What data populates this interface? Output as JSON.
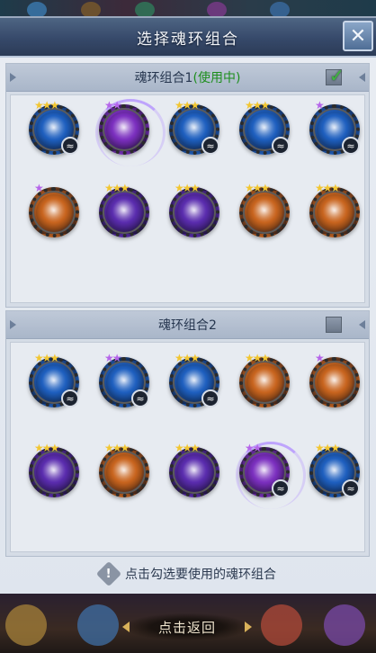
{
  "dialog": {
    "title": "选择魂环组合",
    "close_icon": "close-x-icon"
  },
  "colors": {
    "purple": "#7b2fbf",
    "blue": "#1e5fbf",
    "orange": "#c8641e",
    "violet": "#5a2cae",
    "star_gold": "#f2c631",
    "star_purple": "#b565ea",
    "check_green": "#3fb73f"
  },
  "sets": [
    {
      "name": "魂环组合1",
      "status": "(使用中)",
      "selected": true,
      "rings": [
        [
          {
            "color": "blue",
            "stars": 3,
            "star_color": "star_gold",
            "badge": true,
            "glow": false
          },
          {
            "color": "purple",
            "stars": 2,
            "star_color": "star_purple",
            "badge": false,
            "glow": true
          },
          {
            "color": "blue",
            "stars": 3,
            "star_color": "star_gold",
            "badge": true,
            "glow": false
          },
          {
            "color": "blue",
            "stars": 3,
            "star_color": "star_gold",
            "badge": true,
            "glow": false
          },
          {
            "color": "blue",
            "stars": 1,
            "star_color": "star_purple",
            "badge": true,
            "glow": false
          }
        ],
        [
          {
            "color": "orange",
            "stars": 1,
            "star_color": "star_purple",
            "badge": false,
            "glow": false
          },
          {
            "color": "violet",
            "stars": 3,
            "star_color": "star_gold",
            "badge": false,
            "glow": false
          },
          {
            "color": "violet",
            "stars": 3,
            "star_color": "star_gold",
            "badge": false,
            "glow": false
          },
          {
            "color": "orange",
            "stars": 3,
            "star_color": "star_gold",
            "badge": false,
            "glow": false
          },
          {
            "color": "orange",
            "stars": 3,
            "star_color": "star_gold",
            "badge": false,
            "glow": false
          }
        ]
      ]
    },
    {
      "name": "魂环组合2",
      "status": "",
      "selected": false,
      "rings": [
        [
          {
            "color": "blue",
            "stars": 3,
            "star_color": "star_gold",
            "badge": true,
            "glow": false
          },
          {
            "color": "blue",
            "stars": 2,
            "star_color": "star_purple",
            "badge": true,
            "glow": false
          },
          {
            "color": "blue",
            "stars": 3,
            "star_color": "star_gold",
            "badge": true,
            "glow": false
          },
          {
            "color": "orange",
            "stars": 3,
            "star_color": "star_gold",
            "badge": false,
            "glow": false
          },
          {
            "color": "orange",
            "stars": 1,
            "star_color": "star_purple",
            "badge": false,
            "glow": false
          }
        ],
        [
          {
            "color": "violet",
            "stars": 3,
            "star_color": "star_gold",
            "badge": false,
            "glow": false
          },
          {
            "color": "orange",
            "stars": 3,
            "star_color": "star_gold",
            "badge": false,
            "glow": false
          },
          {
            "color": "violet",
            "stars": 3,
            "star_color": "star_gold",
            "badge": false,
            "glow": false
          },
          {
            "color": "purple",
            "stars": 2,
            "star_color": "star_purple",
            "badge": true,
            "glow": true
          },
          {
            "color": "blue",
            "stars": 3,
            "star_color": "star_gold",
            "badge": true,
            "glow": false
          }
        ]
      ]
    }
  ],
  "hint": {
    "icon": "exclamation-icon",
    "text": "点击勾选要使用的魂环组合"
  },
  "footer": {
    "return_label": "点击返回"
  }
}
